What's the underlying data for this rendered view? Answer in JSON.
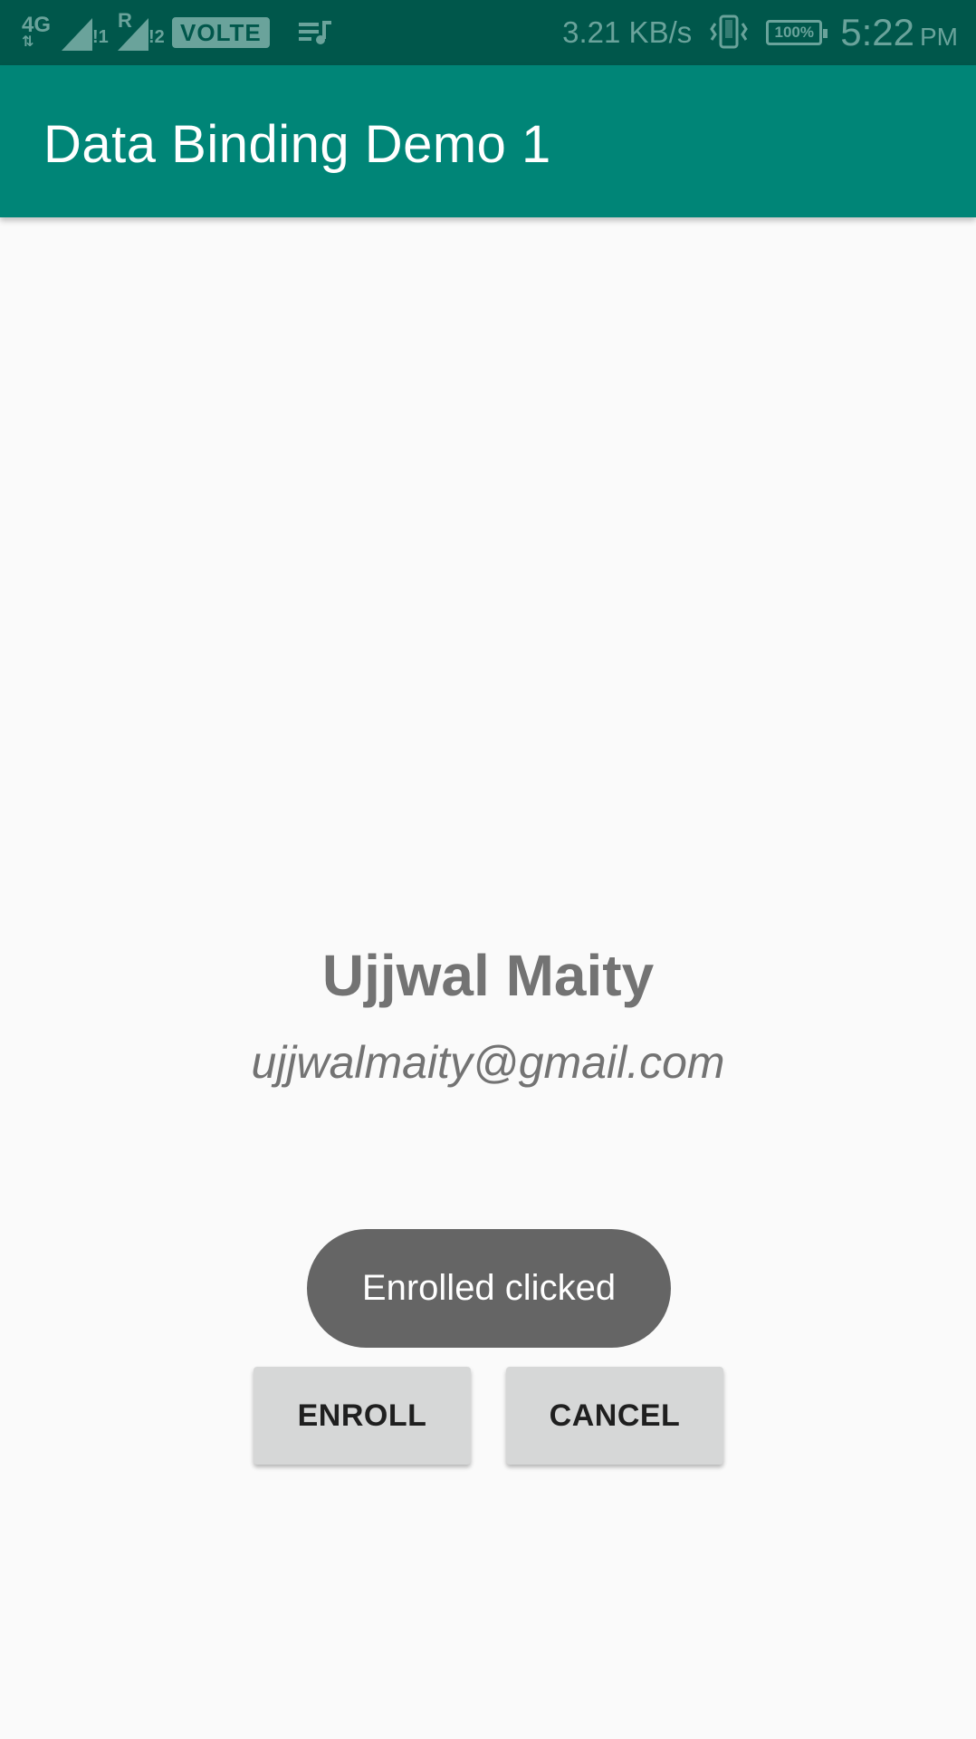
{
  "status_bar": {
    "network_type": "4G",
    "sim1_label": "!1",
    "roaming_label": "R",
    "sim2_label": "!2",
    "volte": "VOLTE",
    "music_icon": "playlist-icon",
    "speed": "3.21 KB/s",
    "vibrate_icon": "vibrate-icon",
    "battery": "100%",
    "time": "5:22",
    "ampm": "PM"
  },
  "app_bar": {
    "title": "Data Binding Demo 1"
  },
  "profile": {
    "name": "Ujjwal Maity",
    "email": "ujjwalmaity@gmail.com"
  },
  "toast": {
    "message": "Enrolled clicked"
  },
  "actions": {
    "enroll_label": "ENROLL",
    "cancel_label": "CANCEL"
  },
  "colors": {
    "status_bar": "#00574b",
    "app_bar": "#008577",
    "background": "#fafafa",
    "text_secondary": "#737373",
    "button": "#d6d7d7",
    "toast": "#656565"
  }
}
